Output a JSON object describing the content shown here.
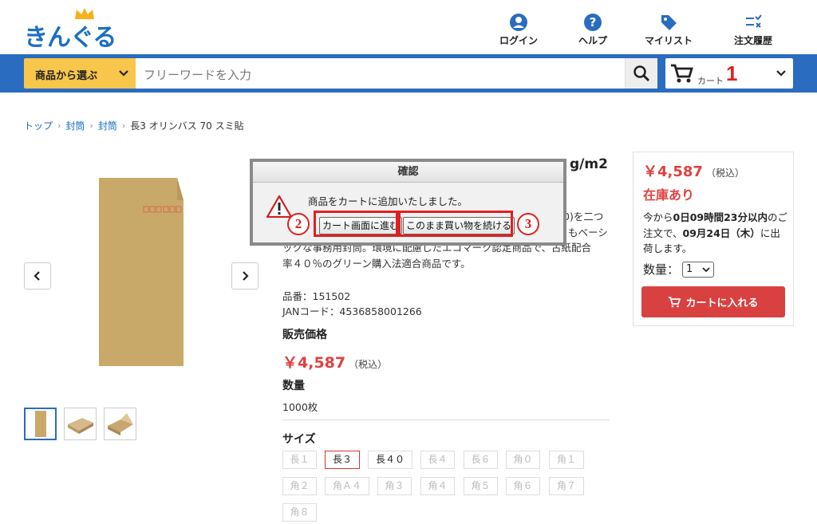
{
  "header": {
    "logo_text": "きんぐる",
    "nav": [
      {
        "label": "ログイン",
        "icon": "user-icon"
      },
      {
        "label": "ヘルプ",
        "icon": "help-icon"
      },
      {
        "label": "マイリスト",
        "icon": "tag-icon"
      },
      {
        "label": "注文履歴",
        "icon": "order-history-icon"
      }
    ]
  },
  "search": {
    "category_label": "商品から選ぶ",
    "placeholder": "フリーワードを入力"
  },
  "cart": {
    "label": "カート",
    "count": "1"
  },
  "breadcrumb": [
    "トップ",
    "封筒",
    "封筒",
    "長3 オリンバス 70 スミ貼"
  ],
  "product": {
    "title_visible": "g/m2",
    "description": "0)を二つ もベーシ ックな事務用封筒。環境に配慮したエコマーク認定商品で、古紙配合率４０％のグリーン購入法適合商品です。",
    "desc_line1": "0)を二つ",
    "desc_line2": "もベーシ",
    "desc_line3": "ックな事務用封筒。環境に配慮したエコマーク認定商品で、古紙配合",
    "desc_line4": "率４０％のグリーン購入法適合商品です。",
    "item_no": "品番：151502",
    "jan": "JANコード：4536858001266",
    "price_heading": "販売価格",
    "price": "￥4,587",
    "tax_note": "（税込）",
    "qty_heading": "数量",
    "qty_value": "1000枚",
    "size_heading": "サイズ",
    "sizes": [
      {
        "label": "長１",
        "state": "disabled"
      },
      {
        "label": "長３",
        "state": "selected"
      },
      {
        "label": "長４０",
        "state": "available"
      },
      {
        "label": "長４",
        "state": "disabled"
      },
      {
        "label": "長６",
        "state": "disabled"
      },
      {
        "label": "角０",
        "state": "disabled"
      },
      {
        "label": "角１",
        "state": "disabled"
      },
      {
        "label": "角２",
        "state": "disabled"
      },
      {
        "label": "角Ａ４",
        "state": "disabled"
      },
      {
        "label": "角３",
        "state": "disabled"
      },
      {
        "label": "角４",
        "state": "disabled"
      },
      {
        "label": "角５",
        "state": "disabled"
      },
      {
        "label": "角６",
        "state": "disabled"
      },
      {
        "label": "角７",
        "state": "disabled"
      },
      {
        "label": "角８",
        "state": "disabled"
      }
    ]
  },
  "buy_box": {
    "price": "￥4,587",
    "tax_note": "（税込）",
    "stock": "在庫あり",
    "ship_1": "今から",
    "ship_time": "0日09時間23分以内",
    "ship_2": "のご注文で、",
    "ship_date": "09月24日（木）",
    "ship_3": "に出荷します。",
    "qty_label": "数量：",
    "qty_value": "1",
    "add_button": "カートに入れる"
  },
  "dialog": {
    "title": "確認",
    "message": "商品をカートに追加いたしました。",
    "go_cart": "カート画面に進む",
    "continue": "このまま買い物を続ける",
    "marker_2": "2",
    "marker_3": "3"
  },
  "colors": {
    "brand_blue": "#2a6cbf",
    "accent_yellow": "#f7c64a",
    "price_red": "#e04040"
  }
}
